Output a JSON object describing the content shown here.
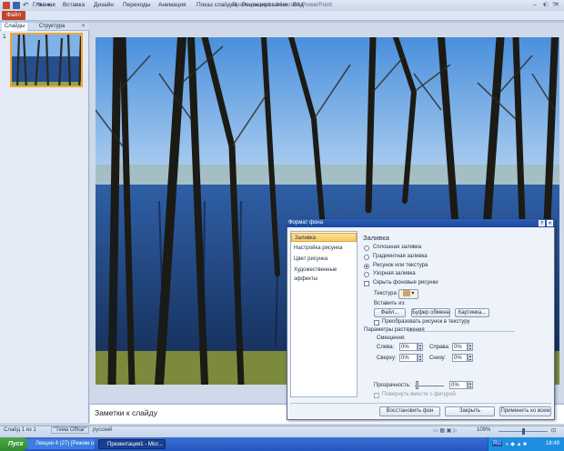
{
  "window": {
    "title": "Презентация1 - Microsoft PowerPoint"
  },
  "ribbon": {
    "file": "Файл",
    "tabs": [
      "Главная",
      "Вставка",
      "Дизайн",
      "Переходы",
      "Анимация",
      "Показ слайдов",
      "Рецензирование",
      "Вид"
    ]
  },
  "left_panel": {
    "tabs": [
      "Слайды",
      "Структура"
    ],
    "close": "×",
    "slide_number": "1"
  },
  "notes": {
    "placeholder": "Заметки к слайду"
  },
  "status": {
    "slide": "Слайд 1 из 1",
    "theme": "\"Тема Office\"",
    "lang": "русский",
    "zoom": "109%"
  },
  "taskbar": {
    "start": "Пуск",
    "tasks": [
      "Лекция 4 (27) [Режим о...",
      "Презентация1 - Micr..."
    ],
    "lang": "RU",
    "time": "18:49"
  },
  "dialog": {
    "title": "Формат фона",
    "help": "?",
    "close": "×",
    "nav": [
      "Заливка",
      "Настройка рисунка",
      "Цвет рисунка",
      "Художественные эффекты"
    ],
    "section": "Заливка",
    "fill_options": [
      "Сплошная заливка",
      "Градиентная заливка",
      "Рисунок или текстура",
      "Узорная заливка"
    ],
    "fill_selected": 2,
    "hide_background": "Скрыть фоновые рисунки",
    "texture_label": "Текстура:",
    "insert_from": "Вставить из:",
    "btn_file": "Файл...",
    "btn_clipboard": "Буфер обмена",
    "btn_clipart": "Картинка...",
    "tile_as_texture": "Преобразовать рисунок в текстуру",
    "stretch_params": "Параметры растяжения",
    "offsets": "Смещения:",
    "left": "Слева:",
    "left_val": "0%",
    "right": "Справа:",
    "right_val": "0%",
    "top": "Сверху:",
    "top_val": "0%",
    "bottom": "Снизу:",
    "bottom_val": "0%",
    "transparency": "Прозрачность:",
    "transparency_val": "0%",
    "rotate_with_shape": "Повернуть вместе с фигурой",
    "btn_reset": "Восстановить фон",
    "btn_close": "Закрыть",
    "btn_apply_all": "Применить ко всем"
  }
}
